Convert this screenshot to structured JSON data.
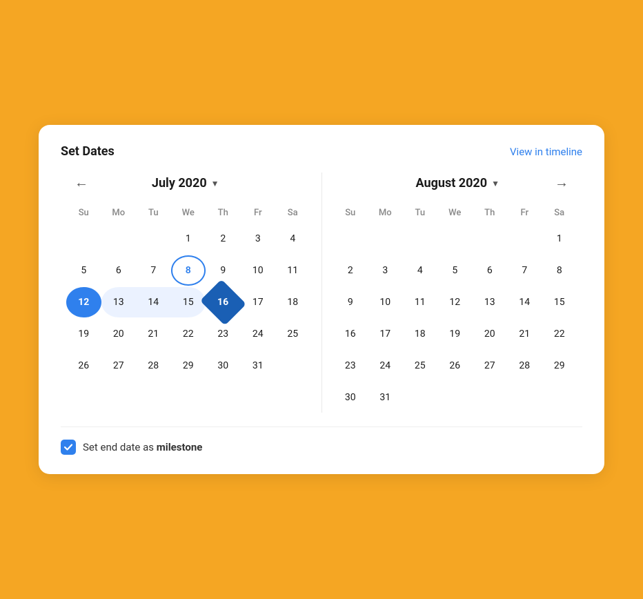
{
  "header": {
    "title": "Set Dates",
    "view_timeline": "View in timeline"
  },
  "left_calendar": {
    "month_label": "July 2020",
    "day_headers": [
      "Su",
      "Mo",
      "Tu",
      "We",
      "Th",
      "Fr",
      "Sa"
    ],
    "weeks": [
      [
        null,
        null,
        null,
        1,
        2,
        3,
        4
      ],
      [
        5,
        6,
        7,
        8,
        9,
        10,
        11
      ],
      [
        12,
        13,
        14,
        15,
        16,
        17,
        18
      ],
      [
        19,
        20,
        21,
        22,
        23,
        24,
        25
      ],
      [
        26,
        27,
        28,
        29,
        30,
        31,
        null
      ]
    ],
    "today": 8,
    "selected_start": 12,
    "selected_end": 16,
    "in_range": [
      13,
      14,
      15
    ]
  },
  "right_calendar": {
    "month_label": "August 2020",
    "day_headers": [
      "Su",
      "Mo",
      "Tu",
      "We",
      "Th",
      "Fr",
      "Sa"
    ],
    "weeks": [
      [
        null,
        null,
        null,
        null,
        null,
        null,
        1
      ],
      [
        2,
        3,
        4,
        5,
        6,
        7,
        8
      ],
      [
        9,
        10,
        11,
        12,
        13,
        14,
        15
      ],
      [
        16,
        17,
        18,
        19,
        20,
        21,
        22
      ],
      [
        23,
        24,
        25,
        26,
        27,
        28,
        29
      ],
      [
        30,
        31,
        null,
        null,
        null,
        null,
        null
      ]
    ]
  },
  "footer": {
    "checkbox_checked": true,
    "label_text": "Set end date as ",
    "label_bold": "milestone"
  },
  "colors": {
    "accent": "#2F80ED",
    "orange_bg": "#F5A623"
  }
}
